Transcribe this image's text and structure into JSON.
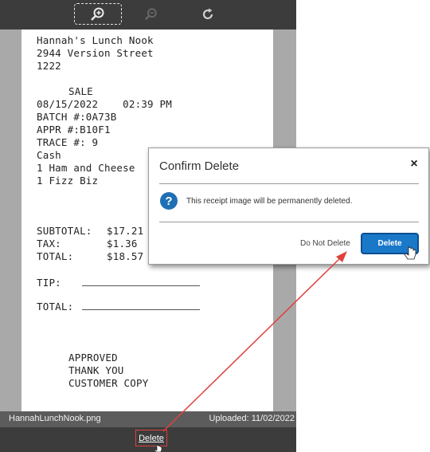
{
  "receipt": {
    "lines": [
      "Hannah's Lunch Nook",
      "2944 Version Street",
      "1222",
      "SALE",
      "08/15/2022    02:39 PM",
      "BATCH #:0A73B",
      "APPR #:B10F1",
      "TRACE #: 9",
      "Cash",
      "1 Ham and Cheese",
      "1 Fizz Biz",
      "SUBTOTAL:",
      "$17.21",
      "TAX:",
      "$1.36",
      "TOTAL:",
      "$18.57",
      "TIP:",
      "TOTAL:",
      "APPROVED",
      "THANK YOU",
      "CUSTOMER COPY"
    ]
  },
  "footer": {
    "filename": "HannahLunchNook.png",
    "uploaded": "Uploaded: 11/02/2022"
  },
  "bottombar": {
    "delete_label": "Delete"
  },
  "dialog": {
    "title": "Confirm Delete",
    "close_label": "×",
    "icon_glyph": "?",
    "message": "This receipt image will be permanently deleted.",
    "cancel_label": "Do Not Delete",
    "confirm_label": "Delete"
  },
  "icons": {
    "zoom_in": "zoom-in-icon",
    "zoom_out": "zoom-out-icon",
    "rotate": "rotate-icon",
    "close": "close-icon",
    "question": "question-icon"
  },
  "colors": {
    "toolbar_bg": "#3c3c3c",
    "viewer_bg": "#a9a9a9",
    "accent": "#1a78c9",
    "annotation": "#e0413b"
  }
}
